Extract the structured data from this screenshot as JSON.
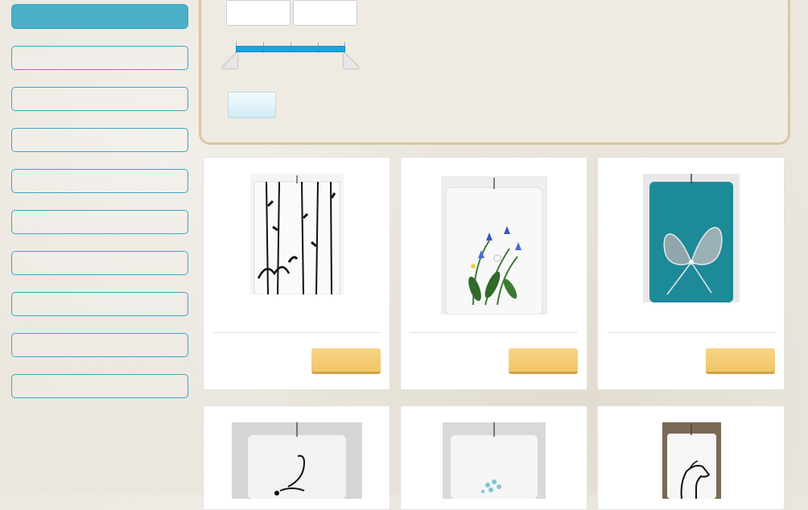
{
  "sidebar": {
    "header": "",
    "items": [
      "",
      "",
      "",
      "",
      "",
      "",
      "",
      "",
      ""
    ]
  },
  "filter": {
    "price_min": "",
    "price_max": "",
    "apply_label": ""
  },
  "products": [
    {
      "name": "",
      "add_to_cart": "",
      "theme": "white-black-birch"
    },
    {
      "name": "",
      "add_to_cart": "",
      "theme": "white-blue-flowers"
    },
    {
      "name": "",
      "add_to_cart": "",
      "theme": "teal-butterfly"
    },
    {
      "name": "",
      "add_to_cart": "",
      "theme": "white-swan"
    },
    {
      "name": "",
      "add_to_cart": "",
      "theme": "white-light-blue-flowers"
    },
    {
      "name": "",
      "add_to_cart": "",
      "theme": "white-horse"
    }
  ],
  "colors": {
    "accent": "#4ab1c9",
    "slider": "#16a6dd",
    "cart_button": "#f0c566",
    "panel_border": "#d9c7a3"
  }
}
